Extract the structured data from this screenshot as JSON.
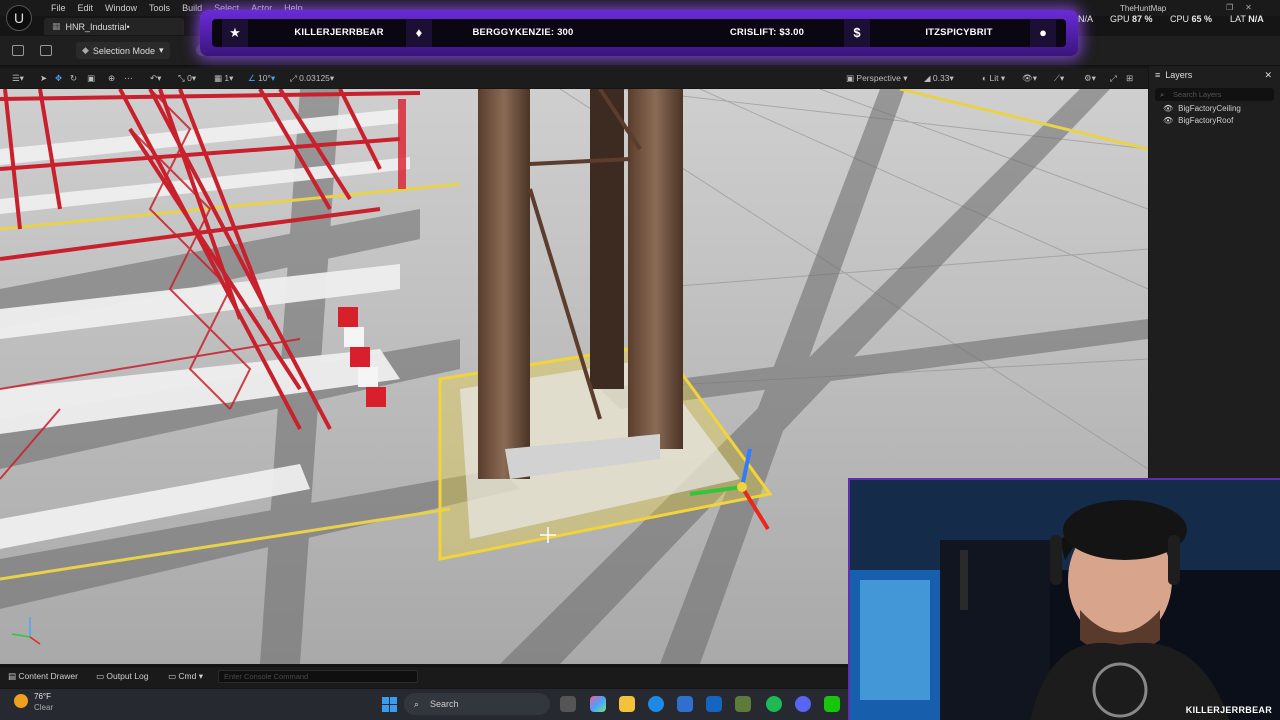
{
  "menu": [
    "File",
    "Edit",
    "Window",
    "Tools",
    "Build",
    "Select",
    "Actor",
    "Help"
  ],
  "project_tab": "HNR_Industrial•",
  "selection_mode": "Selection Mode",
  "banner": {
    "item1": "KILLERJERRBEAR",
    "item2": "BERGGYKENZIE: 300",
    "item3": "CRISLIFT: $3.00",
    "item4": "ITZSPICYBRIT"
  },
  "stats": {
    "map_name": "TheHuntMap",
    "na_label": "N/A",
    "gpu_label": "GPU",
    "gpu_value": "87 %",
    "cpu_label": "CPU",
    "cpu_value": "65 %",
    "lat_label": "LAT",
    "lat_value": "N/A"
  },
  "viewport_toolbar": {
    "rotate_snap": "0",
    "scale_count": "1",
    "angle_snap": "10°",
    "scale_snap": "0.03125",
    "perspective": "Perspective",
    "camera_speed": "0.33",
    "lit": "Lit"
  },
  "layers": {
    "title": "Layers",
    "search_placeholder": "Search Layers",
    "items": [
      "BigFactoryCeiling",
      "BigFactoryRoof"
    ]
  },
  "bottom": {
    "content_drawer": "Content Drawer",
    "output_log": "Output Log",
    "cmd": "Cmd",
    "console_placeholder": "Enter Console Command"
  },
  "taskbar": {
    "weather_temp": "76°F",
    "weather_desc": "Clear",
    "search": "Search"
  },
  "webcam": {
    "name": "KILLERJERRBEAR"
  },
  "colors": {
    "accent_purple": "#6a2bd8",
    "selection_yellow": "#f2d43a",
    "rack_red": "#c8202c"
  }
}
